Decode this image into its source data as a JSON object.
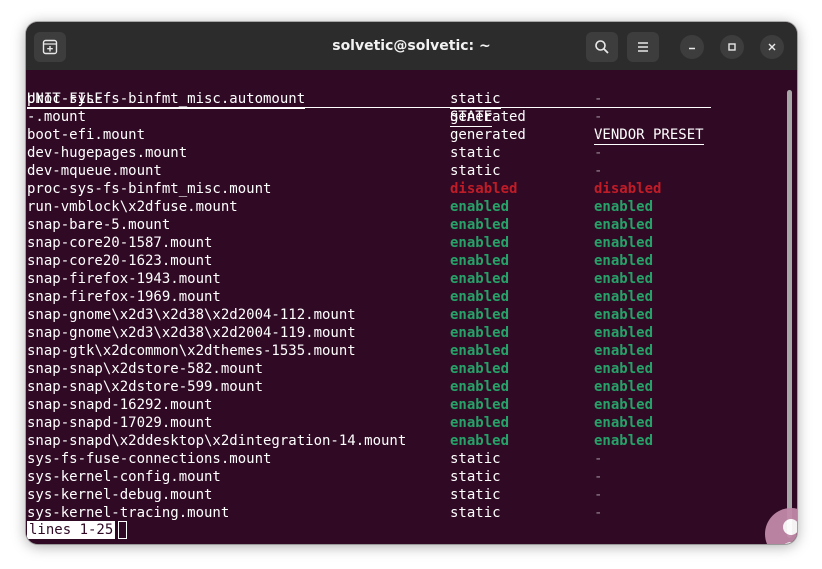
{
  "window": {
    "title": "solvetic@solvetic: ~"
  },
  "icons": {
    "new_tab": "new-tab-icon",
    "search": "search-icon",
    "menu": "hamburger-menu-icon",
    "minimize": "minimize-icon",
    "maximize": "maximize-icon",
    "close": "close-icon"
  },
  "colors": {
    "terminal_bg": "#300a24",
    "enabled": "#26a269",
    "disabled": "#c01c28",
    "titlebar": "#2c2c2c"
  },
  "table": {
    "headers": {
      "unit": "UNIT FILE",
      "state": "STATE",
      "preset": "VENDOR PRESET"
    },
    "rows": [
      {
        "unit": "proc-sys-fs-binfmt_misc.automount",
        "state": "static",
        "preset": "-"
      },
      {
        "unit": "-.mount",
        "state": "generated",
        "preset": "-"
      },
      {
        "unit": "boot-efi.mount",
        "state": "generated",
        "preset": "-"
      },
      {
        "unit": "dev-hugepages.mount",
        "state": "static",
        "preset": "-"
      },
      {
        "unit": "dev-mqueue.mount",
        "state": "static",
        "preset": "-"
      },
      {
        "unit": "proc-sys-fs-binfmt_misc.mount",
        "state": "disabled",
        "preset": "disabled"
      },
      {
        "unit": "run-vmblock\\x2dfuse.mount",
        "state": "enabled",
        "preset": "enabled"
      },
      {
        "unit": "snap-bare-5.mount",
        "state": "enabled",
        "preset": "enabled"
      },
      {
        "unit": "snap-core20-1587.mount",
        "state": "enabled",
        "preset": "enabled"
      },
      {
        "unit": "snap-core20-1623.mount",
        "state": "enabled",
        "preset": "enabled"
      },
      {
        "unit": "snap-firefox-1943.mount",
        "state": "enabled",
        "preset": "enabled"
      },
      {
        "unit": "snap-firefox-1969.mount",
        "state": "enabled",
        "preset": "enabled"
      },
      {
        "unit": "snap-gnome\\x2d3\\x2d38\\x2d2004-112.mount",
        "state": "enabled",
        "preset": "enabled"
      },
      {
        "unit": "snap-gnome\\x2d3\\x2d38\\x2d2004-119.mount",
        "state": "enabled",
        "preset": "enabled"
      },
      {
        "unit": "snap-gtk\\x2dcommon\\x2dthemes-1535.mount",
        "state": "enabled",
        "preset": "enabled"
      },
      {
        "unit": "snap-snap\\x2dstore-582.mount",
        "state": "enabled",
        "preset": "enabled"
      },
      {
        "unit": "snap-snap\\x2dstore-599.mount",
        "state": "enabled",
        "preset": "enabled"
      },
      {
        "unit": "snap-snapd-16292.mount",
        "state": "enabled",
        "preset": "enabled"
      },
      {
        "unit": "snap-snapd-17029.mount",
        "state": "enabled",
        "preset": "enabled"
      },
      {
        "unit": "snap-snapd\\x2ddesktop\\x2dintegration-14.mount",
        "state": "enabled",
        "preset": "enabled"
      },
      {
        "unit": "sys-fs-fuse-connections.mount",
        "state": "static",
        "preset": "-"
      },
      {
        "unit": "sys-kernel-config.mount",
        "state": "static",
        "preset": "-"
      },
      {
        "unit": "sys-kernel-debug.mount",
        "state": "static",
        "preset": "-"
      },
      {
        "unit": "sys-kernel-tracing.mount",
        "state": "static",
        "preset": "-"
      }
    ]
  },
  "pager": {
    "status": "lines 1-25"
  },
  "watermark": {
    "icon": "solvetic-logo-icon"
  }
}
